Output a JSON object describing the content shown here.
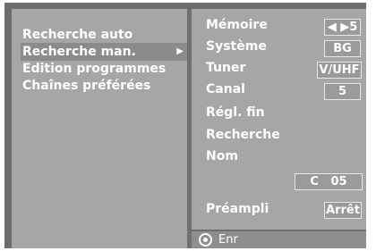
{
  "left_menu": {
    "items": [
      {
        "label": "Recherche auto"
      },
      {
        "label": "Recherche man.",
        "arrow": "▶"
      },
      {
        "label": "Edition programmes"
      },
      {
        "label": "Chaînes préférées"
      }
    ]
  },
  "settings": {
    "memoire": {
      "label": "Mémoire",
      "value": "◀ ▶5"
    },
    "systeme": {
      "label": "Système",
      "value": "BG"
    },
    "tuner": {
      "label": "Tuner",
      "value": "V/UHF"
    },
    "canal": {
      "label": "Canal",
      "value": "5"
    },
    "regl_fin": {
      "label": "Régl. fin"
    },
    "recherche": {
      "label": "Recherche"
    },
    "nom": {
      "label": "Nom",
      "value": "C   05"
    },
    "preampli": {
      "label": "Préampli",
      "value": "Arrêt"
    }
  },
  "footer": {
    "icon": "ok-button-icon",
    "label": "Enr"
  }
}
